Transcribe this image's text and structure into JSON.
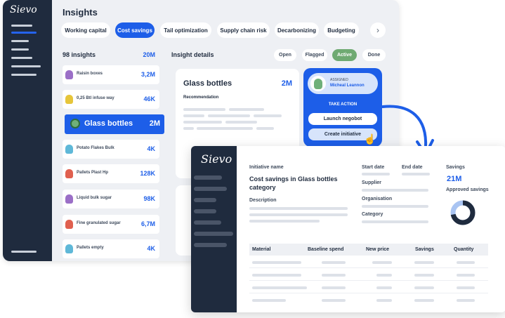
{
  "brand": "Sievo",
  "back": {
    "title": "Insights",
    "chips": [
      {
        "label": "Working capital",
        "active": false
      },
      {
        "label": "Cost savings",
        "active": true
      },
      {
        "label": "Tail optimization",
        "active": false
      },
      {
        "label": "Supply chain risk",
        "active": false
      },
      {
        "label": "Decarbonizing",
        "active": false
      },
      {
        "label": "Budgeting",
        "active": false
      }
    ],
    "chip_next": "›",
    "list": {
      "count_label": "98 insights",
      "total": "20M",
      "items": [
        {
          "name": "Raisin boxes",
          "value": "3,2M",
          "color": "#9b6fc7"
        },
        {
          "name": "0,25 Btl infuse way",
          "value": "46K",
          "color": "#e6c53a"
        },
        {
          "name": "Glass bottles",
          "value": "2M",
          "selected": true
        },
        {
          "name": "Potato Flakes Bulk",
          "value": "4K",
          "color": "#5fb8d8"
        },
        {
          "name": "Pallets Plast Hp",
          "value": "128K",
          "color": "#e0604f"
        },
        {
          "name": "Liquid bulk sugar",
          "value": "98K",
          "color": "#9b6fc7"
        },
        {
          "name": "Fine granulated sugar",
          "value": "6,7M",
          "color": "#e0604f"
        },
        {
          "name": "Pallets empty",
          "value": "4K",
          "color": "#5fb8d8"
        }
      ]
    },
    "details": {
      "heading": "Insight details",
      "tabs": [
        {
          "label": "Open",
          "active": false
        },
        {
          "label": "Flagged",
          "active": false
        },
        {
          "label": "Active",
          "active": true
        },
        {
          "label": "Done",
          "active": false
        }
      ],
      "card_title": "Glass bottles",
      "card_value": "2M",
      "recommendation": "Recommendation"
    },
    "action_panel": {
      "assigned_label": "ASSIGNED",
      "assignee": "Micheal Leannon",
      "take_action": "TAKE ACTION",
      "launch": "Launch negobot",
      "create": "Create initiative"
    }
  },
  "front": {
    "initiative_name_label": "Initiative name",
    "initiative_title": "Cost savings in Glass bottles category",
    "description_label": "Description",
    "start_date_label": "Start date",
    "end_date_label": "End date",
    "supplier_label": "Supplier",
    "organisation_label": "Organisation",
    "category_label": "Category",
    "savings_label": "Savings",
    "savings_value": "21M",
    "approved_label": "Approved savings",
    "approved_fraction": 0.72,
    "table_columns": [
      "Material",
      "Baseline spend",
      "New price",
      "Savings",
      "Quantity"
    ]
  },
  "colors": {
    "accent": "#1d5ee8",
    "sidebar": "#1f2b3e",
    "active_tab": "#6faa72",
    "donut_light": "#a9c4f2"
  }
}
